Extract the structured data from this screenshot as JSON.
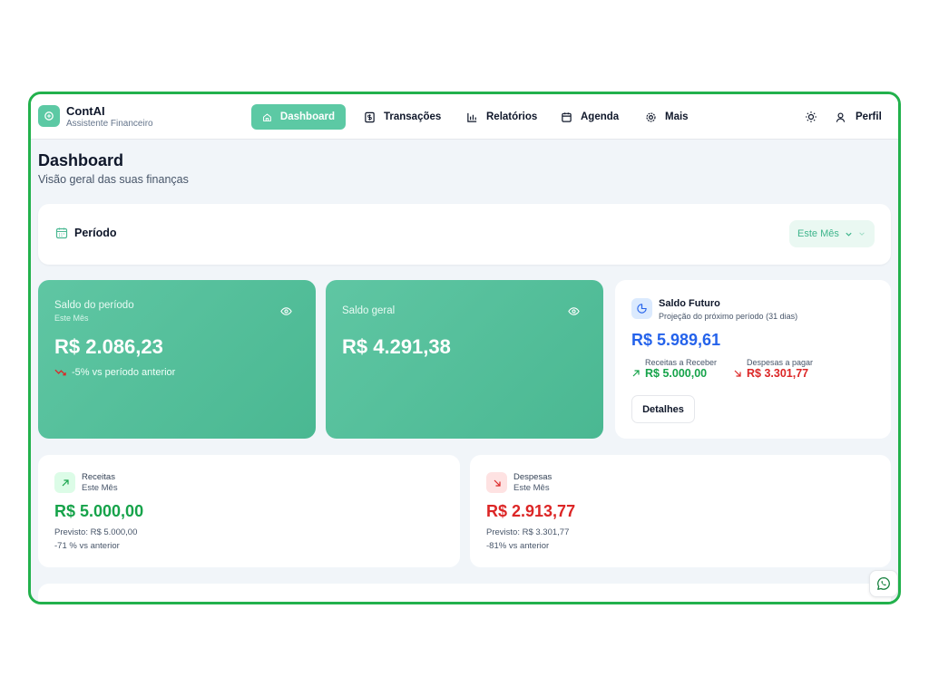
{
  "brand": {
    "name": "ContAI",
    "subtitle": "Assistente Financeiro"
  },
  "nav": {
    "items": [
      {
        "label": "Dashboard",
        "icon": "home-icon",
        "active": true
      },
      {
        "label": "Transações",
        "icon": "dollar-doc-icon"
      },
      {
        "label": "Relatórios",
        "icon": "bar-chart-icon"
      },
      {
        "label": "Agenda",
        "icon": "calendar-icon"
      },
      {
        "label": "Mais",
        "icon": "gear-icon"
      }
    ],
    "theme_icon": "sun-icon",
    "profile_label": "Perfil"
  },
  "page": {
    "title": "Dashboard",
    "subtitle": "Visão geral das suas finanças"
  },
  "period": {
    "label": "Período",
    "selected": "Este Mês"
  },
  "saldo_periodo": {
    "title": "Saldo do período",
    "subtitle": "Este Mês",
    "value": "R$ 2.086,23",
    "trend": "-5% vs período anterior"
  },
  "saldo_geral": {
    "title": "Saldo geral",
    "value": "R$ 4.291,38"
  },
  "saldo_futuro": {
    "title": "Saldo Futuro",
    "subtitle": "Projeção do próximo período (31 dias)",
    "value": "R$ 5.989,61",
    "receitas_label": "Receitas a Receber",
    "receitas_value": "R$ 5.000,00",
    "despesas_label": "Despesas a pagar",
    "despesas_value": "R$ 3.301,77",
    "button": "Detalhes"
  },
  "receitas": {
    "title": "Receitas",
    "subtitle": "Este Mês",
    "value": "R$ 5.000,00",
    "previsto": "Previsto: R$ 5.000,00",
    "comparison": "-71 % vs anterior"
  },
  "despesas": {
    "title": "Despesas",
    "subtitle": "Este Mês",
    "value": "R$ 2.913,77",
    "previsto": "Previsto: R$ 3.301,77",
    "comparison": "-81% vs anterior"
  },
  "colors": {
    "accent": "#5cc9a4",
    "frame": "#22b14c",
    "positive": "#16a34a",
    "negative": "#dc2626",
    "info": "#2563eb"
  }
}
